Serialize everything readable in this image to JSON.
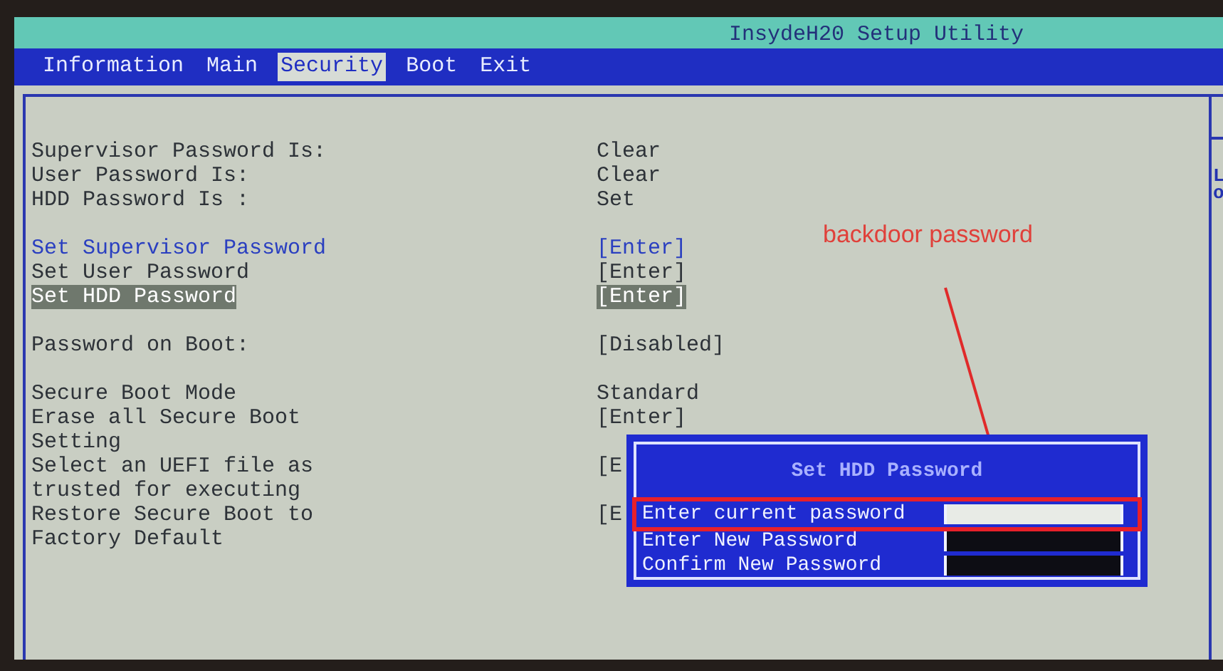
{
  "window": {
    "title": "InsydeH20 Setup Utility"
  },
  "tabs": [
    {
      "label": "Information",
      "selected": false
    },
    {
      "label": "Main",
      "selected": false
    },
    {
      "label": "Security",
      "selected": true
    },
    {
      "label": "Boot",
      "selected": false
    },
    {
      "label": "Exit",
      "selected": false
    }
  ],
  "groups": [
    [
      {
        "label": "Supervisor Password Is:",
        "value": "Clear",
        "selected": false,
        "highlighted": false
      },
      {
        "label": "User Password Is:",
        "value": "Clear",
        "selected": false,
        "highlighted": false
      },
      {
        "label": "HDD Password Is :",
        "value": "Set",
        "selected": false,
        "highlighted": false
      }
    ],
    [
      {
        "label": "Set Supervisor Password",
        "value": "[Enter]",
        "selected": false,
        "highlighted": true
      },
      {
        "label": "Set User Password",
        "value": "[Enter]",
        "selected": false,
        "highlighted": false
      },
      {
        "label": "Set HDD Password",
        "value": "[Enter]",
        "selected": true,
        "highlighted": false
      }
    ],
    [
      {
        "label": "Password on Boot:",
        "value": "[Disabled]",
        "selected": false,
        "highlighted": false
      }
    ],
    [
      {
        "label": "Secure Boot Mode",
        "value": "Standard",
        "selected": false,
        "highlighted": false
      },
      {
        "label": "Erase all Secure Boot\nSetting",
        "value": "[Enter]",
        "selected": false,
        "highlighted": false
      },
      {
        "label": "Select an UEFI file as\ntrusted for executing",
        "value": "[E",
        "selected": false,
        "highlighted": false
      },
      {
        "label": "Restore Secure Boot to\nFactory Default",
        "value": "[E",
        "selected": false,
        "highlighted": false
      }
    ]
  ],
  "help_panel": {
    "lines": [
      "L",
      "o"
    ]
  },
  "dialog": {
    "title": "Set HDD Password",
    "fields": [
      {
        "label": "Enter current password",
        "focused": true,
        "annotated": true
      },
      {
        "label": "Enter New Password",
        "focused": false,
        "annotated": false
      },
      {
        "label": "Confirm New Password",
        "focused": false,
        "annotated": false
      }
    ]
  },
  "annotation": {
    "text": "backdoor password"
  }
}
